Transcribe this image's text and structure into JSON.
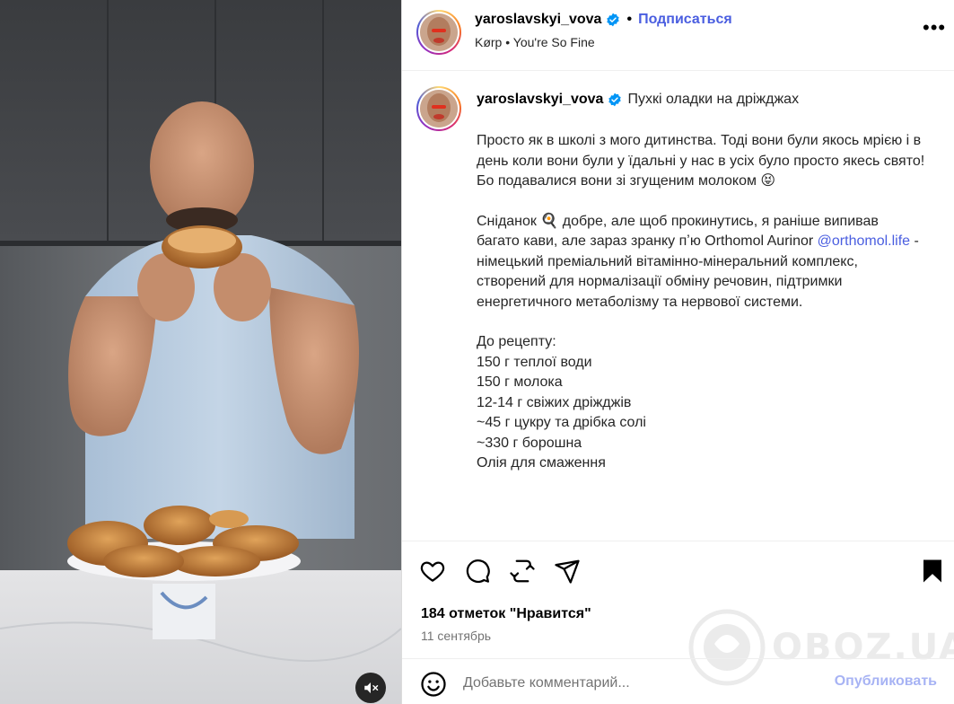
{
  "header": {
    "username": "yaroslavskyi_vova",
    "follow_label": "Подписаться",
    "audio_artist": "Kørp",
    "audio_track": "You're So Fine",
    "more_label": "•••"
  },
  "caption": {
    "username": "yaroslavskyi_vova",
    "title": "Пухкі оладки на дріжджах",
    "para1": "Просто як в школі з мого дитинства. Тоді вони були якось мрією і в день коли вони були у їдальні у нас в усіх було просто якесь свято! Бо подавалися вони зі згущеним молоком 😝",
    "para2_before": "Сніданок 🍳 добре, але щоб прокинутись, я раніше випивав багато кави, але зараз зранку пʼю Orthomol Aurinor ",
    "mention": "@orthomol.life",
    "para2_after": " - німецький преміальний вітамінно-мінеральний комплекс, створений для нормалізації обміну речовин, підтримки енергетичного метаболізму та нервової системи.",
    "recipe_heading": "До рецепту:",
    "recipe_lines": [
      "150 г теплої води",
      "150 г молока",
      "12-14 г свіжих дріжджів",
      "~45 г цукру та дрібка солі",
      "~330 г борошна",
      "Олія для смаження"
    ]
  },
  "actions": {
    "likes": "184 отметок \"Нравится\"",
    "date": "11 сентябрь"
  },
  "comment": {
    "placeholder": "Добавьте комментарий...",
    "publish_label": "Опубликовать"
  },
  "watermark": {
    "text": "OBOZ.UA"
  },
  "colors": {
    "link": "#4a5ee0",
    "publish_disabled": "#a7b3f4",
    "verified": "#0095f6"
  }
}
